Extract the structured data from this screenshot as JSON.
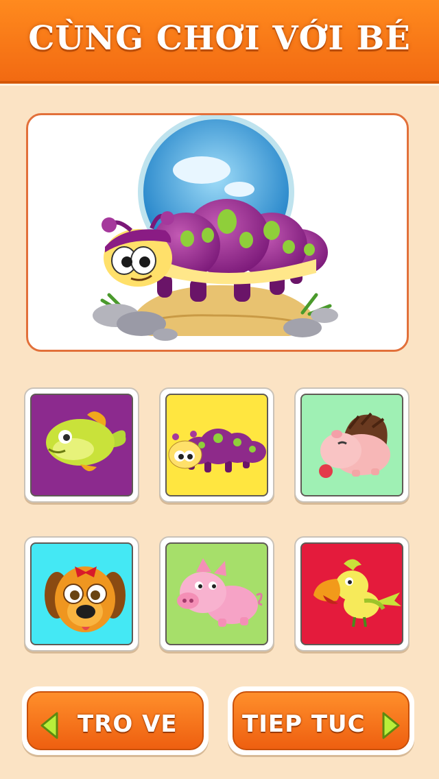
{
  "header": {
    "title": "CÙNG CHƠI VỚI BÉ"
  },
  "preview": {
    "animal": "caterpillar"
  },
  "tiles": [
    {
      "animal": "fish",
      "bg": "#8c2a8e"
    },
    {
      "animal": "caterpillar",
      "bg": "#ffe640"
    },
    {
      "animal": "hedgehog",
      "bg": "#9ff0b4"
    },
    {
      "animal": "dog",
      "bg": "#44e8f4"
    },
    {
      "animal": "pig",
      "bg": "#a6df6a"
    },
    {
      "animal": "parrot",
      "bg": "#e41b3c"
    }
  ],
  "buttons": {
    "back_label": "TRO VE",
    "next_label": "TIEP TUC"
  },
  "icons": {
    "back": "chevron-left-icon",
    "next": "chevron-right-icon"
  }
}
